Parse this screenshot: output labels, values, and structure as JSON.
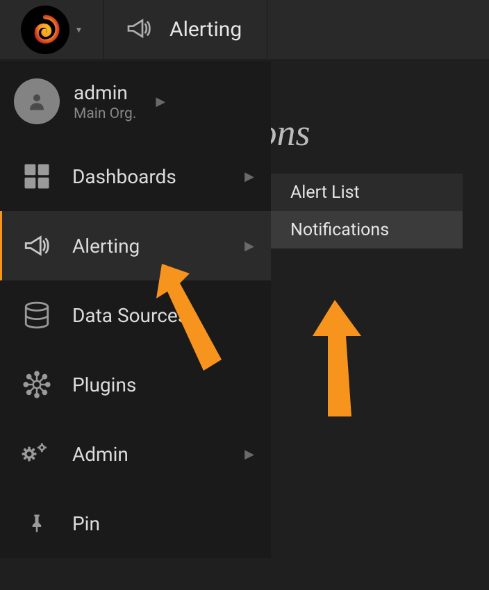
{
  "header": {
    "title": "Alerting"
  },
  "page": {
    "title": "Alert notifications"
  },
  "user": {
    "name": "admin",
    "org": "Main Org."
  },
  "menu": {
    "dashboards": "Dashboards",
    "alerting": "Alerting",
    "data_sources": "Data Sources",
    "plugins": "Plugins",
    "admin": "Admin",
    "pin": "Pin"
  },
  "submenu": {
    "alert_list": "Alert List",
    "notifications": "Notifications"
  },
  "colors": {
    "accent": "#f7941e"
  }
}
